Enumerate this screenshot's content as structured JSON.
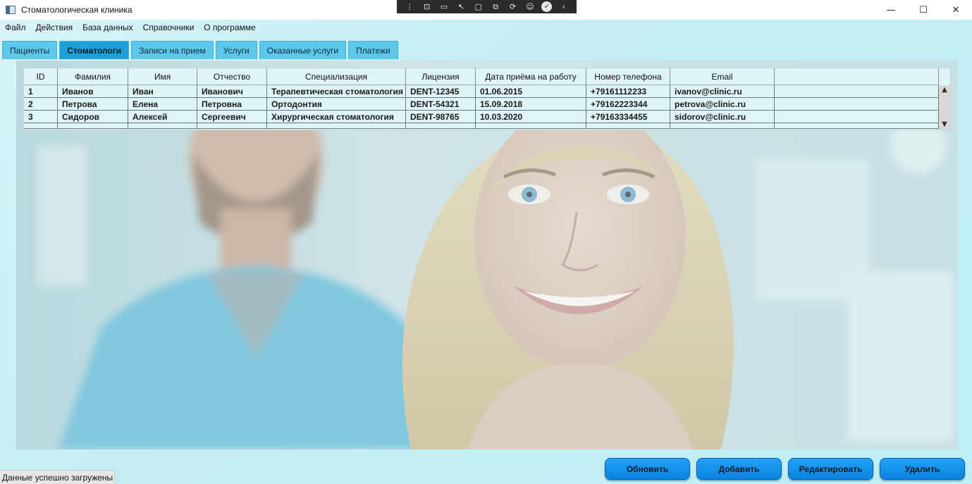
{
  "window": {
    "title": "Стоматологическая клиника",
    "controls": [
      "—",
      "☐",
      "✕"
    ]
  },
  "menu": [
    "Файл",
    "Действия",
    "База данных",
    "Справочники",
    "О программе"
  ],
  "tabs": [
    {
      "label": "Пациенты",
      "active": false
    },
    {
      "label": "Стоматологи",
      "active": true
    },
    {
      "label": "Записи на прием",
      "active": false
    },
    {
      "label": "Услуги",
      "active": false
    },
    {
      "label": "Оказанные услуги",
      "active": false
    },
    {
      "label": "Платежи",
      "active": false
    }
  ],
  "grid": {
    "columns": [
      "ID",
      "Фамилия",
      "Имя",
      "Отчество",
      "Специализация",
      "Лицензия",
      "Дата приёма на работу",
      "Номер телефона",
      "Email"
    ],
    "rows": [
      [
        "1",
        "Иванов",
        "Иван",
        "Иванович",
        "Терапевтическая стоматология",
        "DENT-12345",
        "01.06.2015",
        "+79161112233",
        "ivanov@clinic.ru"
      ],
      [
        "2",
        "Петрова",
        "Елена",
        "Петровна",
        "Ортодонтия",
        "DENT-54321",
        "15.09.2018",
        "+79162223344",
        "petrova@clinic.ru"
      ],
      [
        "3",
        "Сидоров",
        "Алексей",
        "Сергеевич",
        "Хирургическая стоматология",
        "DENT-98765",
        "10.03.2020",
        "+79163334455",
        "sidorov@clinic.ru"
      ]
    ]
  },
  "buttons": {
    "refresh": "Обновить",
    "add": "Добавить",
    "edit": "Редактировать",
    "delete": "Удалить"
  },
  "status": "Данные успешно загружены",
  "colors": {
    "tab": "#5ec8ea",
    "tab_active": "#1f9fd8",
    "button": "#1190e8",
    "grid_bg": "#dff4f7"
  }
}
